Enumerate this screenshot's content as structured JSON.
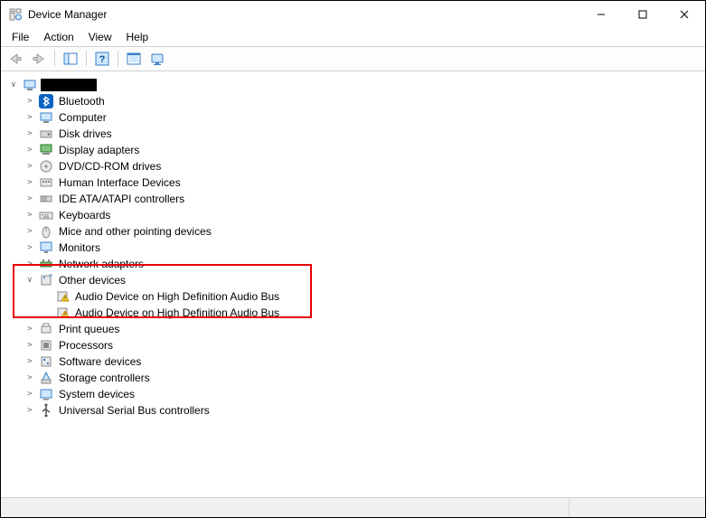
{
  "window": {
    "title": "Device Manager"
  },
  "menu": {
    "file": "File",
    "action": "Action",
    "view": "View",
    "help": "Help"
  },
  "tree": {
    "root_label": "",
    "categories": [
      {
        "label": "Bluetooth",
        "expanded": false
      },
      {
        "label": "Computer",
        "expanded": false
      },
      {
        "label": "Disk drives",
        "expanded": false
      },
      {
        "label": "Display adapters",
        "expanded": false
      },
      {
        "label": "DVD/CD-ROM drives",
        "expanded": false
      },
      {
        "label": "Human Interface Devices",
        "expanded": false
      },
      {
        "label": "IDE ATA/ATAPI controllers",
        "expanded": false
      },
      {
        "label": "Keyboards",
        "expanded": false
      },
      {
        "label": "Mice and other pointing devices",
        "expanded": false
      },
      {
        "label": "Monitors",
        "expanded": false
      },
      {
        "label": "Network adapters",
        "expanded": false
      },
      {
        "label": "Other devices",
        "expanded": true,
        "children": [
          {
            "label": "Audio Device on High Definition Audio Bus",
            "problem": true
          },
          {
            "label": "Audio Device on High Definition Audio Bus",
            "problem": true
          }
        ]
      },
      {
        "label": "Print queues",
        "expanded": false
      },
      {
        "label": "Processors",
        "expanded": false
      },
      {
        "label": "Software devices",
        "expanded": false
      },
      {
        "label": "Storage controllers",
        "expanded": false
      },
      {
        "label": "System devices",
        "expanded": false
      },
      {
        "label": "Universal Serial Bus controllers",
        "expanded": false
      }
    ]
  }
}
